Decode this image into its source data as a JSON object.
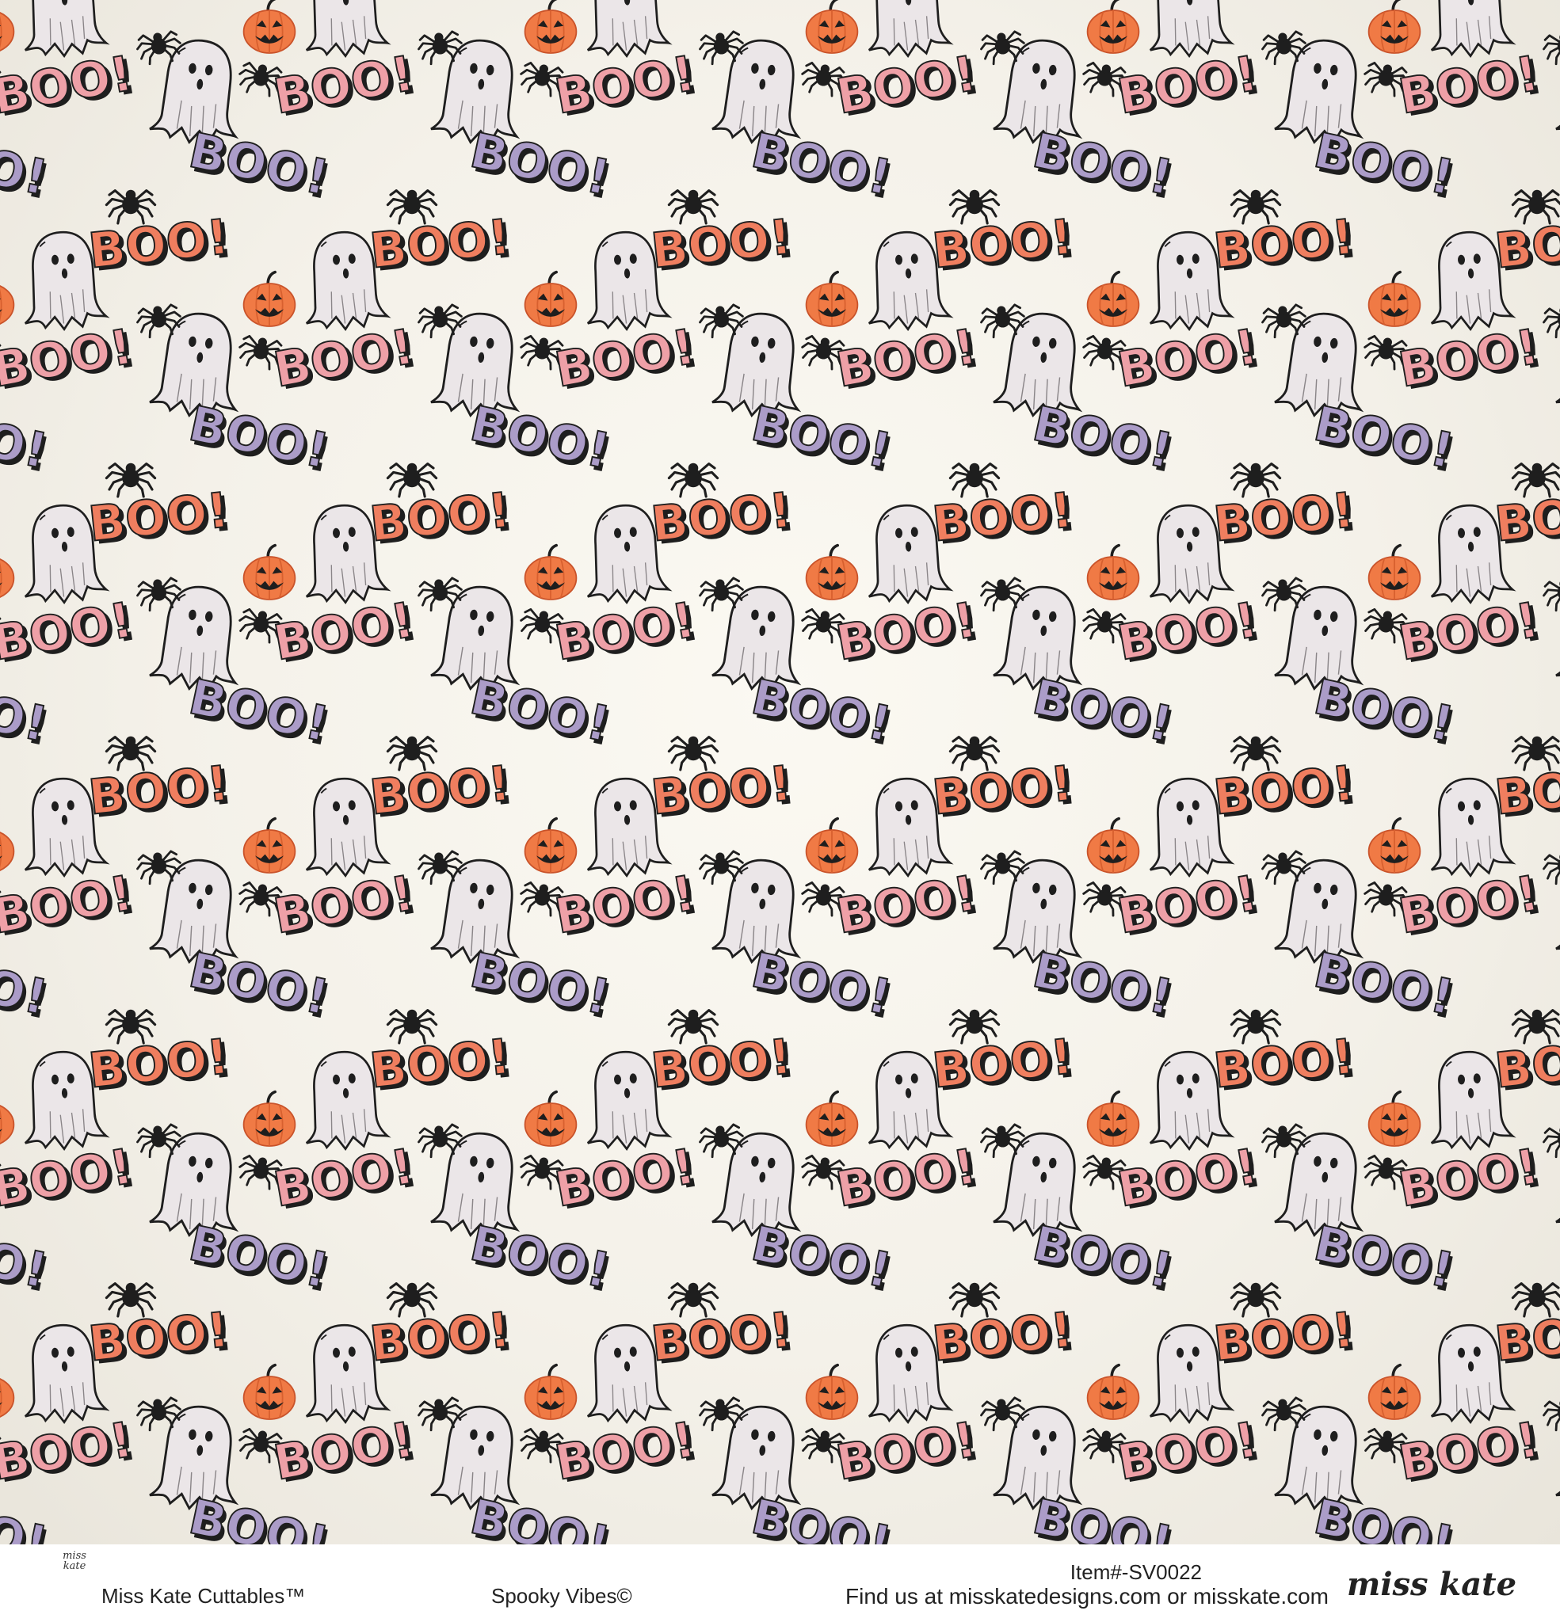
{
  "pattern": {
    "words": [
      "BOO!"
    ],
    "motifs": [
      "ghost-icon",
      "spider-icon",
      "pumpkin-icon"
    ],
    "colors": {
      "background": "#f4f1e9",
      "boo_pink": "#eea0a7",
      "boo_orange": "#ef7e5f",
      "boo_purple": "#ab9cc8",
      "ghost_fill": "#ebe6e8",
      "pumpkin": "#f07a45",
      "spider": "#1e1e1e"
    }
  },
  "footer": {
    "brand_mark": "miss kate",
    "brand_name": "Miss Kate Cuttables™",
    "collection": "Spooky Vibes©",
    "item_number": "Item#-SV0022",
    "find_us": "Find us at misskatedesigns.com or misskate.com",
    "logo_text": "miss kate"
  }
}
